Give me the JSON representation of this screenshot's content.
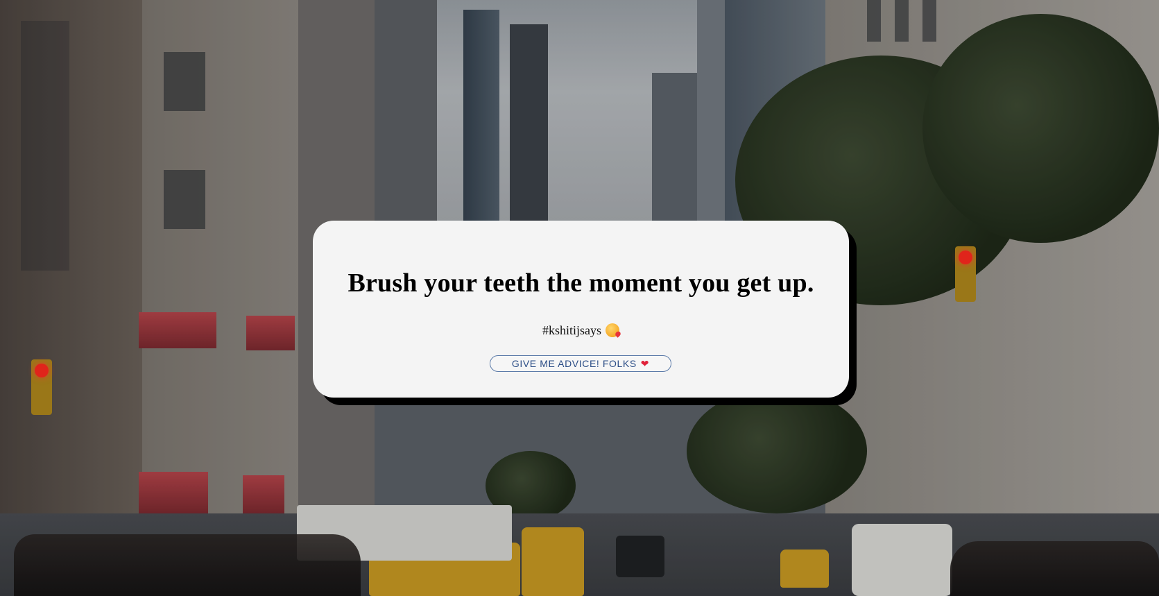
{
  "advice": {
    "text": "Brush your teeth the moment you get up.",
    "tag": "#kshitijsays"
  },
  "button": {
    "label": "GIVE ME ADVICE! FOLKS",
    "icon": "heart-icon"
  },
  "icons": {
    "tag_emoji": "kiss-emoji-icon"
  },
  "colors": {
    "card_background": "#f4f4f4",
    "card_shadow": "#000000",
    "button_text": "#2b4d86",
    "button_border": "#5a7aa8",
    "heart": "#e0223a"
  }
}
